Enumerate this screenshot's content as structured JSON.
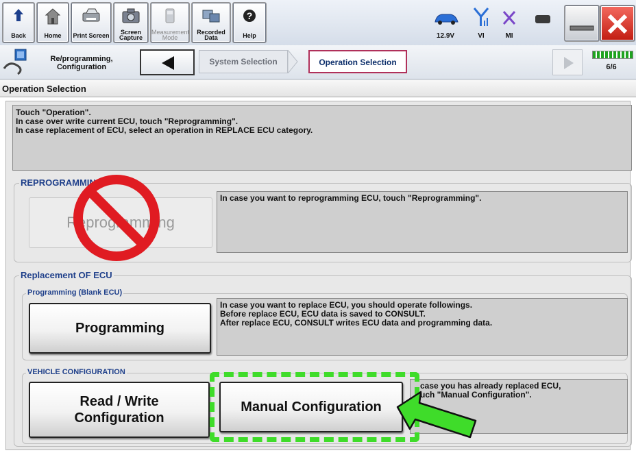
{
  "toolbar": {
    "back": "Back",
    "home": "Home",
    "print_screen": "Print Screen",
    "screen_capture": "Screen Capture",
    "measurement_mode": "Measurement Mode",
    "recorded_data": "Recorded Data",
    "help": "Help",
    "battery_voltage": "12.9V",
    "vi": "VI",
    "mi": "MI"
  },
  "nav": {
    "module_label": "Re/programming, Configuration",
    "step_system": "System Selection",
    "step_operation": "Operation Selection",
    "progress": "6/6"
  },
  "page_title": "Operation Selection",
  "instructions": [
    "Touch \"Operation\".",
    "In case over write current ECU, touch \"Reprogramming\".",
    "In case replacement of ECU, select an operation in REPLACE ECU category."
  ],
  "reprogramming": {
    "legend": "REPROGRAMMING",
    "button": "Reprogramming",
    "description": "In case you want to reprogramming ECU, touch \"Reprogramming\"."
  },
  "replacement": {
    "legend": "Replacement OF ECU",
    "programming_legend": "Programming (Blank ECU)",
    "programming_button": "Programming",
    "programming_desc": [
      "In case you want to replace ECU, you should operate followings.",
      "Before replace ECU, ECU data is saved to CONSULT.",
      "After replace ECU, CONSULT writes ECU data and programming data."
    ],
    "vehicle_config_legend": "VEHICLE CONFIGURATION",
    "read_write_line1": "Read / Write",
    "read_write_line2": "Configuration",
    "manual_button": "Manual Configuration",
    "manual_desc": [
      "case you has already replaced ECU,",
      "uch \"Manual Configuration\"."
    ]
  },
  "colors": {
    "accent_blue": "#1e3f8a",
    "prohibit_red": "#e01b22",
    "highlight_green": "#3fdc2a",
    "active_step_border": "#b0305a"
  },
  "icons": [
    "back-arrow-icon",
    "home-icon",
    "printer-icon",
    "camera-icon",
    "meter-icon",
    "recorded-data-icon",
    "help-icon",
    "car-icon",
    "signal-icon",
    "mi-x-icon",
    "battery-icon",
    "minimize-icon",
    "close-icon",
    "programming-module-icon",
    "prohibited-icon",
    "pointer-arrow-icon"
  ]
}
